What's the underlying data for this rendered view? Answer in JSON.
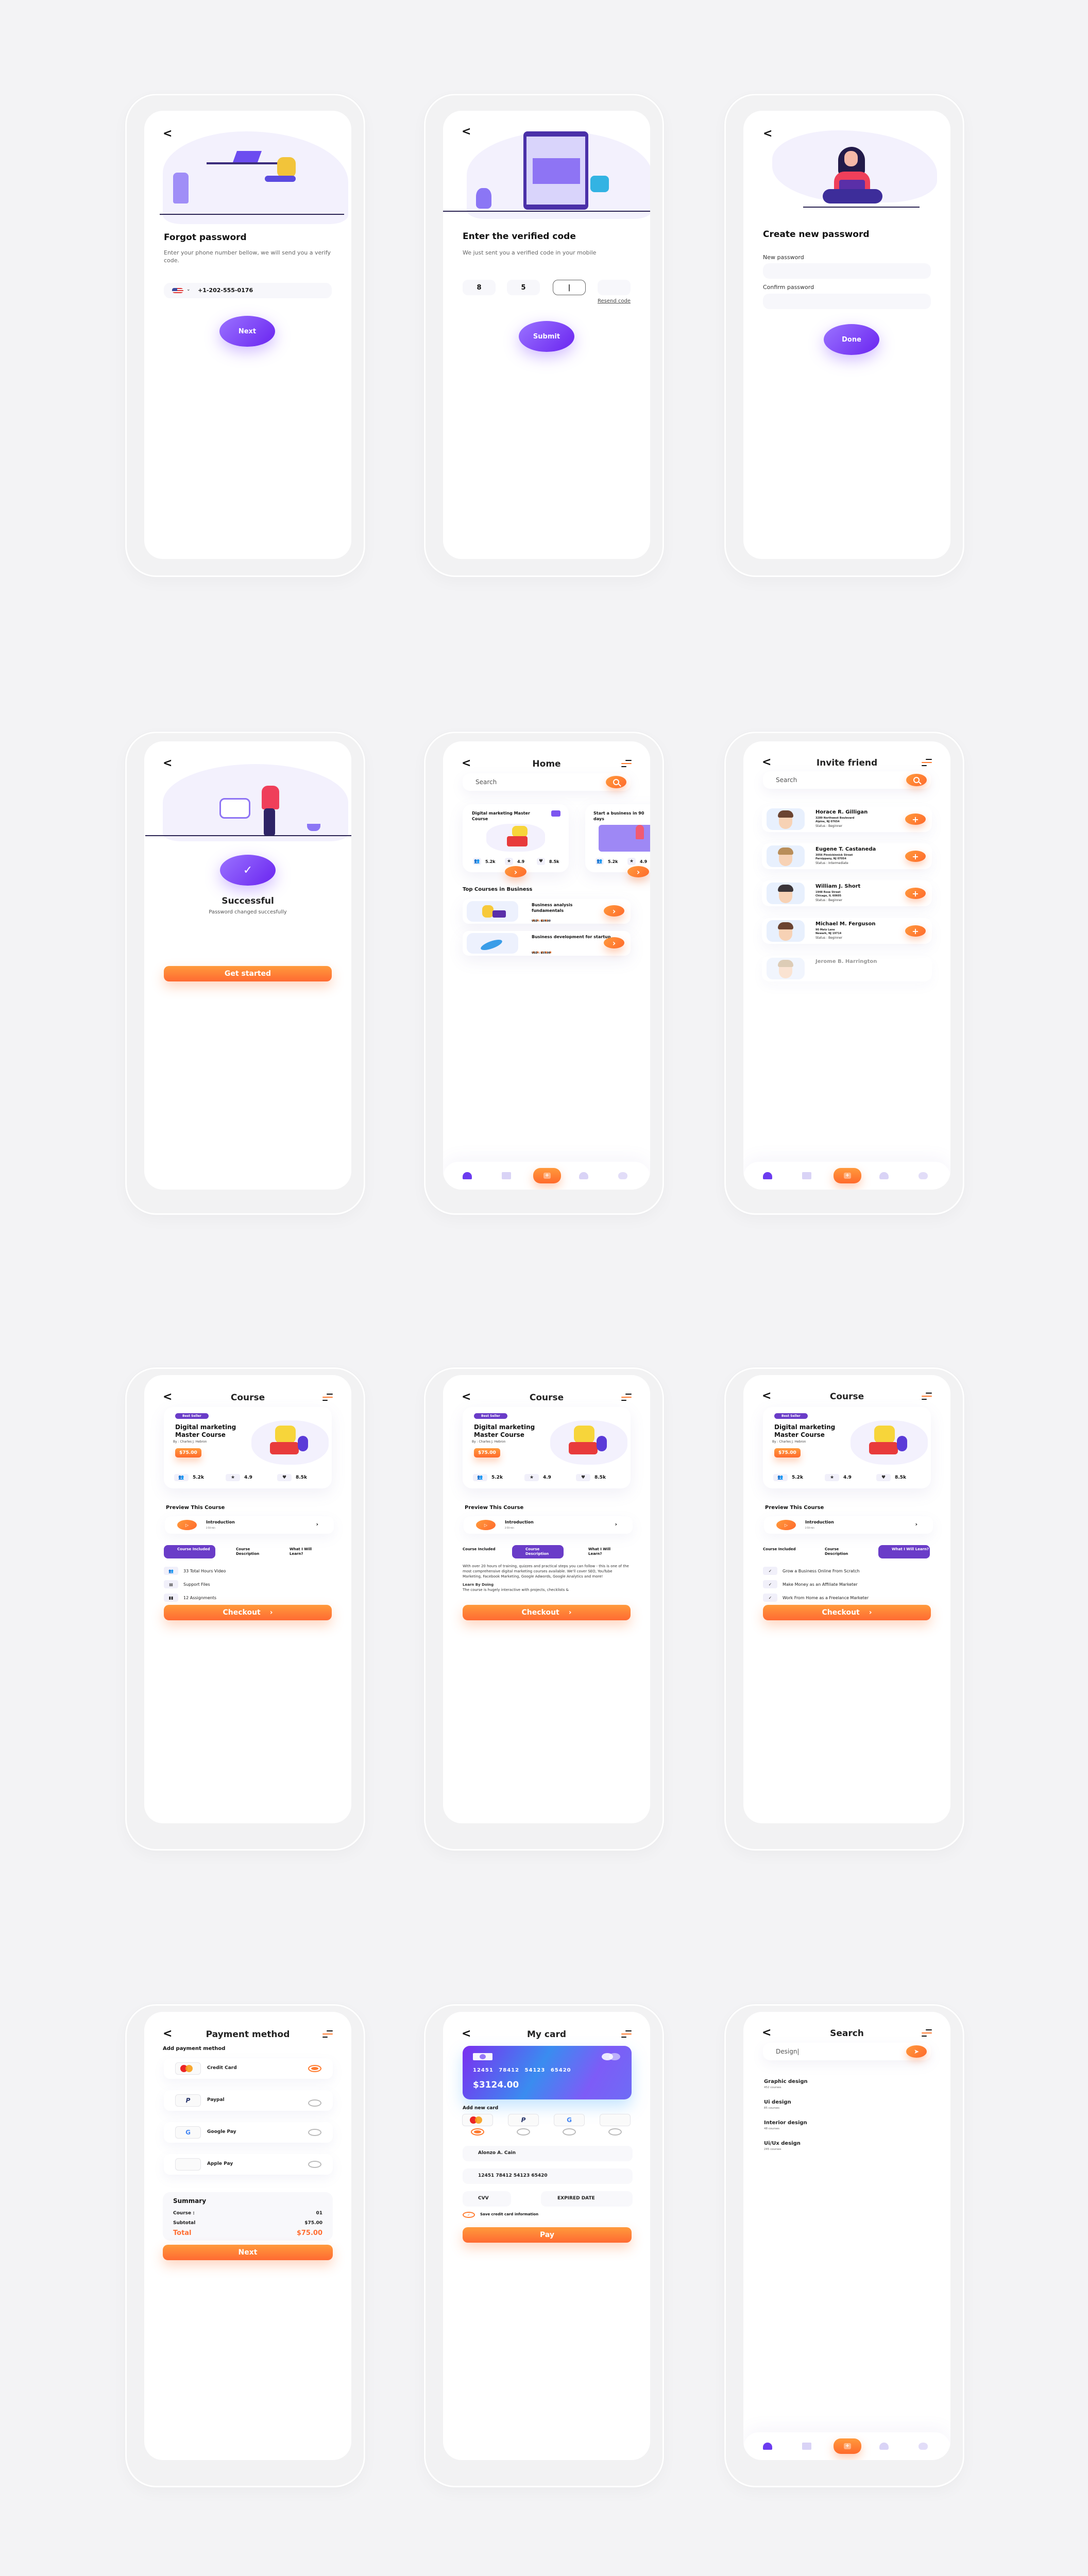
{
  "colors": {
    "purple": "#6c3cf0",
    "orange": "#ff7a2e",
    "background": "#f3f3f5"
  },
  "forgot": {
    "title": "Forgot password",
    "description": "Enter your phone number bellow, we will send you a verify code.",
    "country": "US",
    "phone": "+1-202-555-0176",
    "button": "Next"
  },
  "verify": {
    "title": "Enter the verified code",
    "description": "We just sent you a verified code in your mobile",
    "digits": [
      "8",
      "5",
      "|",
      ""
    ],
    "resend": "Resend code",
    "button": "Submit"
  },
  "create": {
    "title": "Create  new password",
    "new_label": "New password",
    "confirm_label": "Confirm password",
    "button": "Done"
  },
  "success": {
    "title": "Successful",
    "subtitle": "Password changed succesfully",
    "button": "Get started"
  },
  "home": {
    "title": "Home",
    "search_placeholder": "Search",
    "featured": [
      {
        "title": "Digital marketing Master Course",
        "learners": "5.2k",
        "rating": "4.9",
        "likes": "8.5k"
      },
      {
        "title": "Start a business in 90 days",
        "learners": "5.2k",
        "rating": "4.9",
        "likes": ""
      }
    ],
    "section_title": "Top Courses in Business",
    "top_courses": [
      {
        "title": "Business analysis fundamentals",
        "rating": 4,
        "max_rating": 5,
        "price": "USD : $29.00"
      },
      {
        "title": "Business development for startup",
        "rating": 5,
        "max_rating": 5,
        "price": "USD : $35.00"
      }
    ]
  },
  "invite": {
    "title": "Invite friend",
    "search_placeholder": "Search",
    "friends": [
      {
        "name": "Horace R. Gilligan",
        "address1": "3289 Northwest Boulevard",
        "address2": "Alpine, NJ 07654",
        "status": "Status : Beginner"
      },
      {
        "name": "Eugene T. Castaneda",
        "address1": "3056 Pinnickinnick Street",
        "address2": "Parsippany, NJ 07054",
        "status": "Status : Intermediate"
      },
      {
        "name": "William J. Short",
        "address1": "1948 Rose Street",
        "address2": "Chicago, IL 60605",
        "status": "Status : Beginner"
      },
      {
        "name": "Michael M. Ferguson",
        "address1": "90 Metz Lane",
        "address2": "Newark, NJ 19714",
        "status": "Status : Beginner"
      },
      {
        "name": "Jerome B. Harrington",
        "address1": "",
        "address2": "",
        "status": ""
      }
    ]
  },
  "course": {
    "title": "Course",
    "badge": "Best Seller",
    "course_title": "Digital marketing Master Course",
    "author": "By : Charles J. Hebron",
    "price": "$75.00",
    "learners": "5.2k",
    "rating": "4.9",
    "likes": "8.5k",
    "preview_title": "Preview This Course",
    "intro_title": "Introduction",
    "intro_duration": "2:50 min",
    "tabs": [
      "Course Included",
      "Course Description",
      "What I Will Learn?"
    ],
    "included": [
      "33 Total Hours Video",
      "Support Files",
      "12 Assignments"
    ],
    "description": "With over 20 hours of training, quizzes and practical steps you can follow - this is one of the most comprehensive digital marketing courses available. We'll cover SEO, YouTube Marketing, Facebook Marketing, Google Adwords, Google Analytics and more!",
    "description_heading": "Learn By Doing",
    "description_more": "The course is hugely interactive with projects, checklists &",
    "learn": [
      "Grow a Business Online From Scratch",
      "Make Money as an Affiliate Marketer",
      "Work From Home as a Freelance Marketer"
    ],
    "checkout": "Checkout"
  },
  "payment": {
    "title": "Payment method",
    "subtitle": "Add payment method",
    "methods": [
      {
        "name": "Credit Card",
        "selected": true
      },
      {
        "name": "Paypal",
        "selected": false
      },
      {
        "name": "Google Pay",
        "selected": false
      },
      {
        "name": "Apple Pay",
        "selected": false
      }
    ],
    "summary_title": "Summary",
    "course_label": "Course :",
    "course_count": "01",
    "subtotal_label": "Subtotal",
    "subtotal": "$75.00",
    "total_label": "Total",
    "total": "$75.00",
    "button": "Next"
  },
  "mycard": {
    "title": "My card",
    "card_number": "12451  78412  54123  65420",
    "balance": "$3124.00",
    "add_title": "Add new card",
    "selected_method": "Credit Card",
    "holder": "Alonzo A. Cain",
    "number": "12451  78412  54123  65420",
    "cvv_placeholder": "CVV",
    "expiry_placeholder": "EXPIRED DATE",
    "save_label": "Save credit card information",
    "button": "Pay"
  },
  "search": {
    "title": "Search",
    "query": "Design|",
    "results": [
      {
        "title": "Graphic design",
        "count": "452 courses"
      },
      {
        "title": "Ui design",
        "count": "85 courses"
      },
      {
        "title": "Interior design",
        "count": "48 courses"
      },
      {
        "title": "Ui/Ux design",
        "count": "245 courses"
      }
    ]
  },
  "icons": {
    "back": "‹",
    "chevron": "›",
    "plus": "+",
    "check": "✓",
    "play": "▷",
    "send": "➤",
    "star": "★",
    "heart": "♥",
    "people": "👥"
  }
}
